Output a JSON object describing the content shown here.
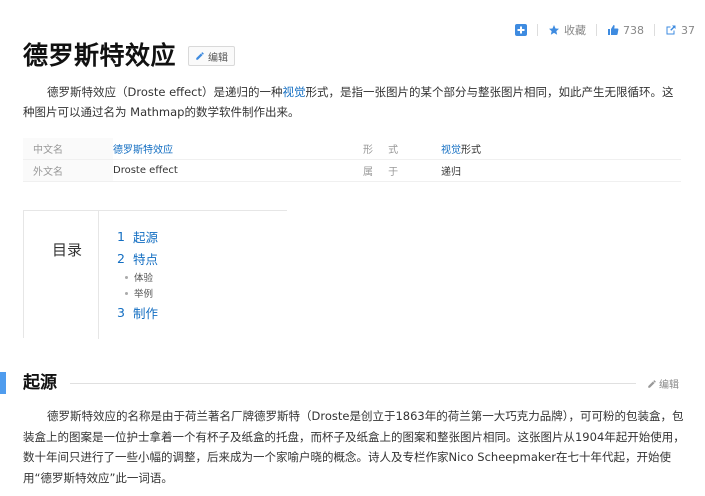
{
  "toolbar": {
    "favorite_label": "收藏",
    "like_count": "738",
    "share_count": "37"
  },
  "header": {
    "title": "德罗斯特效应",
    "edit_label": "编辑"
  },
  "summary": {
    "part1": "德罗斯特效应（Droste effect）是递归的一种",
    "link": "视觉",
    "part2": "形式，是指一张图片的某个部分与整张图片相同，如此产生无限循环。这种图片可以通过名为 Mathmap的数学软件制作出来。"
  },
  "infobox": {
    "rows": [
      {
        "k1": "中文名",
        "v1": "德罗斯特效应",
        "k2": "形  式",
        "v2_link": "视觉",
        "v2_text": "形式"
      },
      {
        "k1": "外文名",
        "v1": "Droste effect",
        "k2": "属  于",
        "v2_link": "",
        "v2_text": "递归"
      }
    ]
  },
  "toc": {
    "title": "目录",
    "items": [
      {
        "num": "1",
        "label": "起源"
      },
      {
        "num": "2",
        "label": "特点"
      },
      {
        "num": "3",
        "label": "制作"
      }
    ],
    "subitems": [
      "体验",
      "举例"
    ]
  },
  "section": {
    "title": "起源",
    "edit_label": "编辑",
    "paragraph": "德罗斯特效应的名称是由于荷兰著名厂牌德罗斯特（Droste是创立于1863年的荷兰第一大巧克力品牌），可可粉的包装盒，包装盒上的图案是一位护士拿着一个有杯子及纸盒的托盘，而杯子及纸盒上的图案和整张图片相同。这张图片从1904年起开始使用，数十年间只进行了一些小幅的调整，后来成为一个家喻户晓的概念。诗人及专栏作家Nico Scheepmaker在七十年代起，开始使用“德罗斯特效应”此一词语。"
  },
  "colors": {
    "link": "#136ec2",
    "accent_bar": "#4f9cee"
  }
}
